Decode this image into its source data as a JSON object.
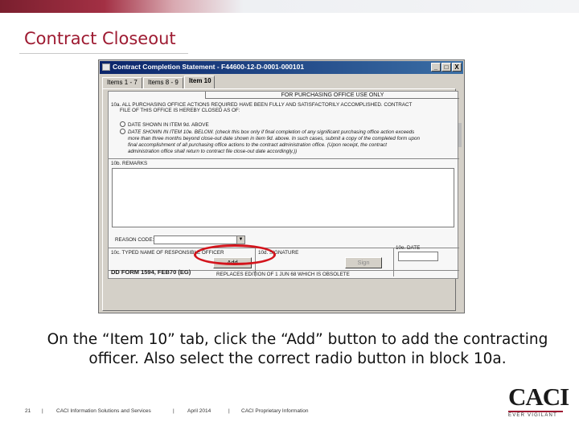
{
  "slide": {
    "title": "Contract Closeout",
    "caption": "On the “Item 10” tab, click the “Add” button to add the contracting officer. Also select the correct radio button in block 10a."
  },
  "window": {
    "title": "Contract Completion Statement - F44600-12-D-0001-000101",
    "controls": [
      "_",
      "□",
      "X"
    ],
    "tabs": [
      {
        "label": "Items 1 - 7"
      },
      {
        "label": "Items 8 - 9"
      },
      {
        "label": "Item 10"
      }
    ],
    "active_tab": "Item 10"
  },
  "form": {
    "header": "FOR PURCHASING OFFICE USE ONLY",
    "block10a_line1": "10a. ALL PURCHASING OFFICE ACTIONS REQUIRED HAVE BEEN FULLY AND SATISFACTORILY ACCOMPLISHED. CONTRACT",
    "block10a_line2": "FILE OF THIS OFFICE IS HEREBY CLOSED AS OF:",
    "radio1_label": "DATE SHOWN IN ITEM 9d. ABOVE",
    "radio2_line1": "DATE SHOWN IN ITEM 10e. BELOW. (check this box only if final completion of any significant purchasing office action exceeds",
    "radio2_line2": "more than three months beyond close-out date shown in item 9d. above. In such cases, submit a copy of the completed form upon",
    "radio2_line3": "final accomplishment of all purchasing office actions to the contract administration office. (Upon receipt, the contract",
    "radio2_line4": "administration office shall return to contract file close-out date accordingly.))",
    "block10b_label": "10b. REMARKS",
    "reason_code_label": "REASON CODE:",
    "reason_code_value": "",
    "block10c_label": "10c. TYPED NAME OF RESPONSIBLE OFFICER",
    "block10d_label": "10d. SIGNATURE",
    "block10e_label": "10e. DATE",
    "add_button": "Add",
    "sign_button": "Sign",
    "form_id": "DD FORM 1594, FEB70 (EG)",
    "edition_note": "REPLACES EDITION OF 1 JUN 68 WHICH IS OBSOLETE"
  },
  "footer": {
    "page_number": "21",
    "separator": "|",
    "company": "CACI Information Solutions and Services",
    "date": "April 2014",
    "classification": "CACI Proprietary Information"
  },
  "logo": {
    "word": "CACI",
    "tagline": "EVER VIGILANT",
    "accent_color": "#9e1b32"
  },
  "colors": {
    "title_color": "#9e1b32",
    "highlight_color": "#d3141c",
    "titlebar_color": "#0a246a"
  }
}
